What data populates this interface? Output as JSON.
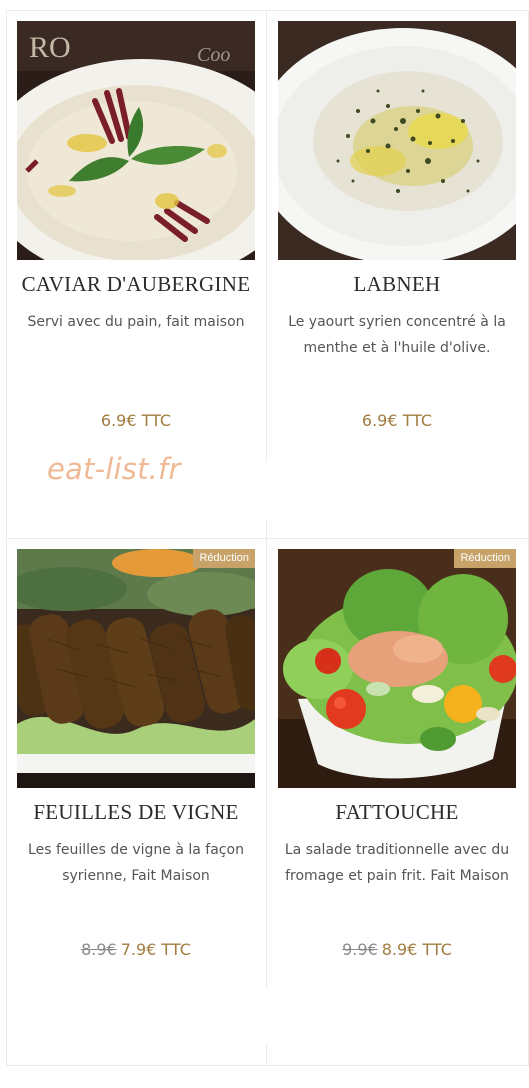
{
  "items": [
    {
      "title": "CAVIAR D'AUBERGINE",
      "description": "Servi avec du pain, fait maison",
      "price": "6.9€ TTC",
      "badge": ""
    },
    {
      "title": "LABNEH",
      "description": "Le yaourt syrien concentré à la menthe et à l'huile d'olive.",
      "price": "6.9€ TTC",
      "badge": ""
    },
    {
      "title": "FEUILLES DE VIGNE",
      "description": "Les feuilles de vigne à la façon syrienne, Fait Maison",
      "old_price": "8.9€",
      "price": "7.9€ TTC",
      "badge": "Réduction"
    },
    {
      "title": "FATTOUCHE",
      "description": "La salade traditionnelle avec du fromage et pain frit. Fait Maison",
      "old_price": "9.9€",
      "price": "8.9€ TTC",
      "badge": "Réduction"
    }
  ],
  "watermark": "eat-list.fr",
  "colors": {
    "price": "#a07c3e",
    "badge": "#c7a36a",
    "watermark": "#f0b996"
  }
}
